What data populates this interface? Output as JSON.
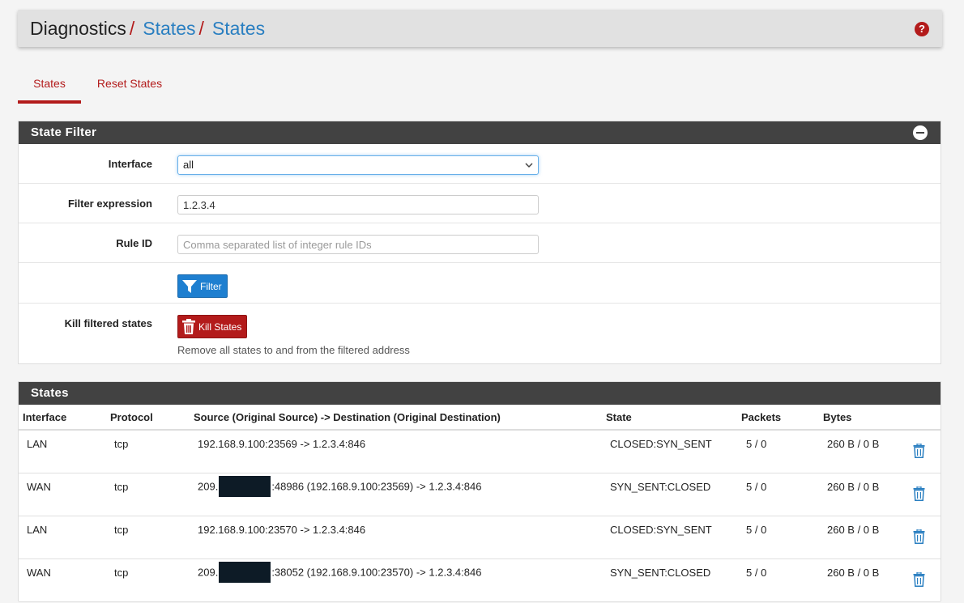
{
  "breadcrumb": {
    "root": "Diagnostics",
    "separator": "/",
    "items": [
      "States",
      "States"
    ]
  },
  "help_icon": "?",
  "tabs": [
    {
      "label": "States",
      "active": true
    },
    {
      "label": "Reset States",
      "active": false
    }
  ],
  "filter_panel": {
    "title": "State Filter",
    "interface_label": "Interface",
    "interface_value": "all",
    "filter_expression_label": "Filter expression",
    "filter_expression_value": "1.2.3.4",
    "rule_id_label": "Rule ID",
    "rule_id_placeholder": "Comma separated list of integer rule IDs",
    "filter_button": "Filter",
    "kill_label": "Kill filtered states",
    "kill_button": "Kill States",
    "kill_help": "Remove all states to and from the filtered address"
  },
  "states_panel": {
    "title": "States",
    "columns": [
      "Interface",
      "Protocol",
      "Source (Original Source) -> Destination (Original Destination)",
      "State",
      "Packets",
      "Bytes"
    ],
    "rows": [
      {
        "interface": "LAN",
        "protocol": "tcp",
        "src_prefix": "192.168.9.100:23569 -> 1.2.3.4:846",
        "redacted": false,
        "src_suffix": "",
        "state": "CLOSED:SYN_SENT",
        "packets": "5 / 0",
        "bytes": "260 B / 0 B"
      },
      {
        "interface": "WAN",
        "protocol": "tcp",
        "src_prefix": "209.",
        "redacted": true,
        "src_suffix": ":48986 (192.168.9.100:23569) -> 1.2.3.4:846",
        "state": "SYN_SENT:CLOSED",
        "packets": "5 / 0",
        "bytes": "260 B / 0 B"
      },
      {
        "interface": "LAN",
        "protocol": "tcp",
        "src_prefix": "192.168.9.100:23570 -> 1.2.3.4:846",
        "redacted": false,
        "src_suffix": "",
        "state": "CLOSED:SYN_SENT",
        "packets": "5 / 0",
        "bytes": "260 B / 0 B"
      },
      {
        "interface": "WAN",
        "protocol": "tcp",
        "src_prefix": "209.",
        "redacted": true,
        "src_suffix": ":38052 (192.168.9.100:23570) -> 1.2.3.4:846",
        "state": "SYN_SENT:CLOSED",
        "packets": "5 / 0",
        "bytes": "260 B / 0 B"
      }
    ]
  },
  "colors": {
    "accent_red": "#b31b1b",
    "link_blue": "#2a7fc1",
    "panel_heading": "#424242",
    "button_blue": "#1e7fd0"
  }
}
